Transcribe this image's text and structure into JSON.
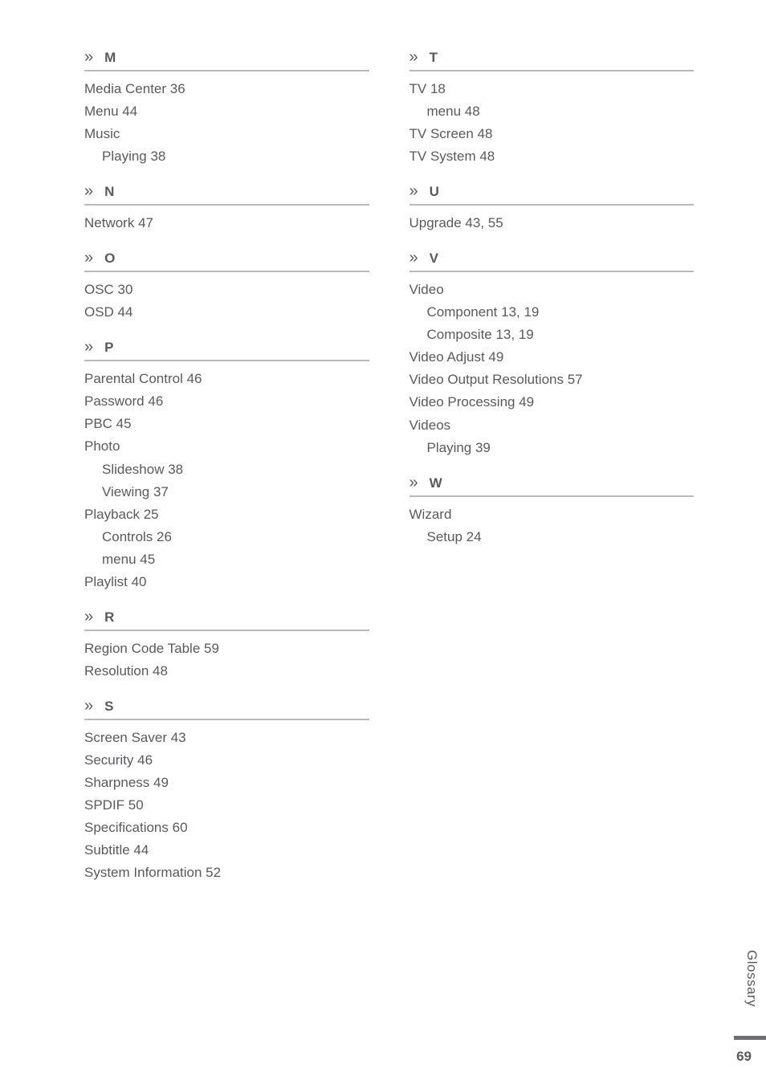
{
  "left": [
    {
      "letter": "M",
      "entries": [
        {
          "text": "Media Center  36"
        },
        {
          "text": "Menu  44"
        },
        {
          "text": "Music"
        },
        {
          "text": "Playing  38",
          "sub": true
        }
      ]
    },
    {
      "letter": "N",
      "entries": [
        {
          "text": "Network  47"
        }
      ]
    },
    {
      "letter": "O",
      "entries": [
        {
          "text": "OSC  30"
        },
        {
          "text": "OSD  44"
        }
      ]
    },
    {
      "letter": "P",
      "entries": [
        {
          "text": "Parental Control  46"
        },
        {
          "text": "Password  46"
        },
        {
          "text": "PBC  45"
        },
        {
          "text": "Photo"
        },
        {
          "text": "Slideshow  38",
          "sub": true
        },
        {
          "text": "Viewing  37",
          "sub": true
        },
        {
          "text": "Playback  25"
        },
        {
          "text": "Controls  26",
          "sub": true
        },
        {
          "text": "menu  45",
          "sub": true
        },
        {
          "text": "Playlist  40"
        }
      ]
    },
    {
      "letter": "R",
      "entries": [
        {
          "text": "Region Code Table  59"
        },
        {
          "text": "Resolution  48"
        }
      ]
    },
    {
      "letter": "S",
      "entries": [
        {
          "text": "Screen Saver  43"
        },
        {
          "text": "Security  46"
        },
        {
          "text": "Sharpness  49"
        },
        {
          "text": "SPDIF  50"
        },
        {
          "text": "Specifications  60"
        },
        {
          "text": "Subtitle  44"
        },
        {
          "text": "System Information  52"
        }
      ]
    }
  ],
  "right": [
    {
      "letter": "T",
      "entries": [
        {
          "text": "TV  18"
        },
        {
          "text": "menu  48",
          "sub": true
        },
        {
          "text": "TV Screen  48"
        },
        {
          "text": "TV System  48"
        }
      ]
    },
    {
      "letter": "U",
      "entries": [
        {
          "text": "Upgrade  43, 55"
        }
      ]
    },
    {
      "letter": "V",
      "entries": [
        {
          "text": "Video"
        },
        {
          "text": "Component  13, 19",
          "sub": true
        },
        {
          "text": "Composite  13, 19",
          "sub": true
        },
        {
          "text": "Video Adjust  49"
        },
        {
          "text": "Video Output Resolutions  57"
        },
        {
          "text": "Video Processing  49"
        },
        {
          "text": "Videos"
        },
        {
          "text": "Playing  39",
          "sub": true
        }
      ]
    },
    {
      "letter": "W",
      "entries": [
        {
          "text": "Wizard"
        },
        {
          "text": "Setup  24",
          "sub": true
        }
      ]
    }
  ],
  "side_tab": "Glossary",
  "page_number": "69"
}
